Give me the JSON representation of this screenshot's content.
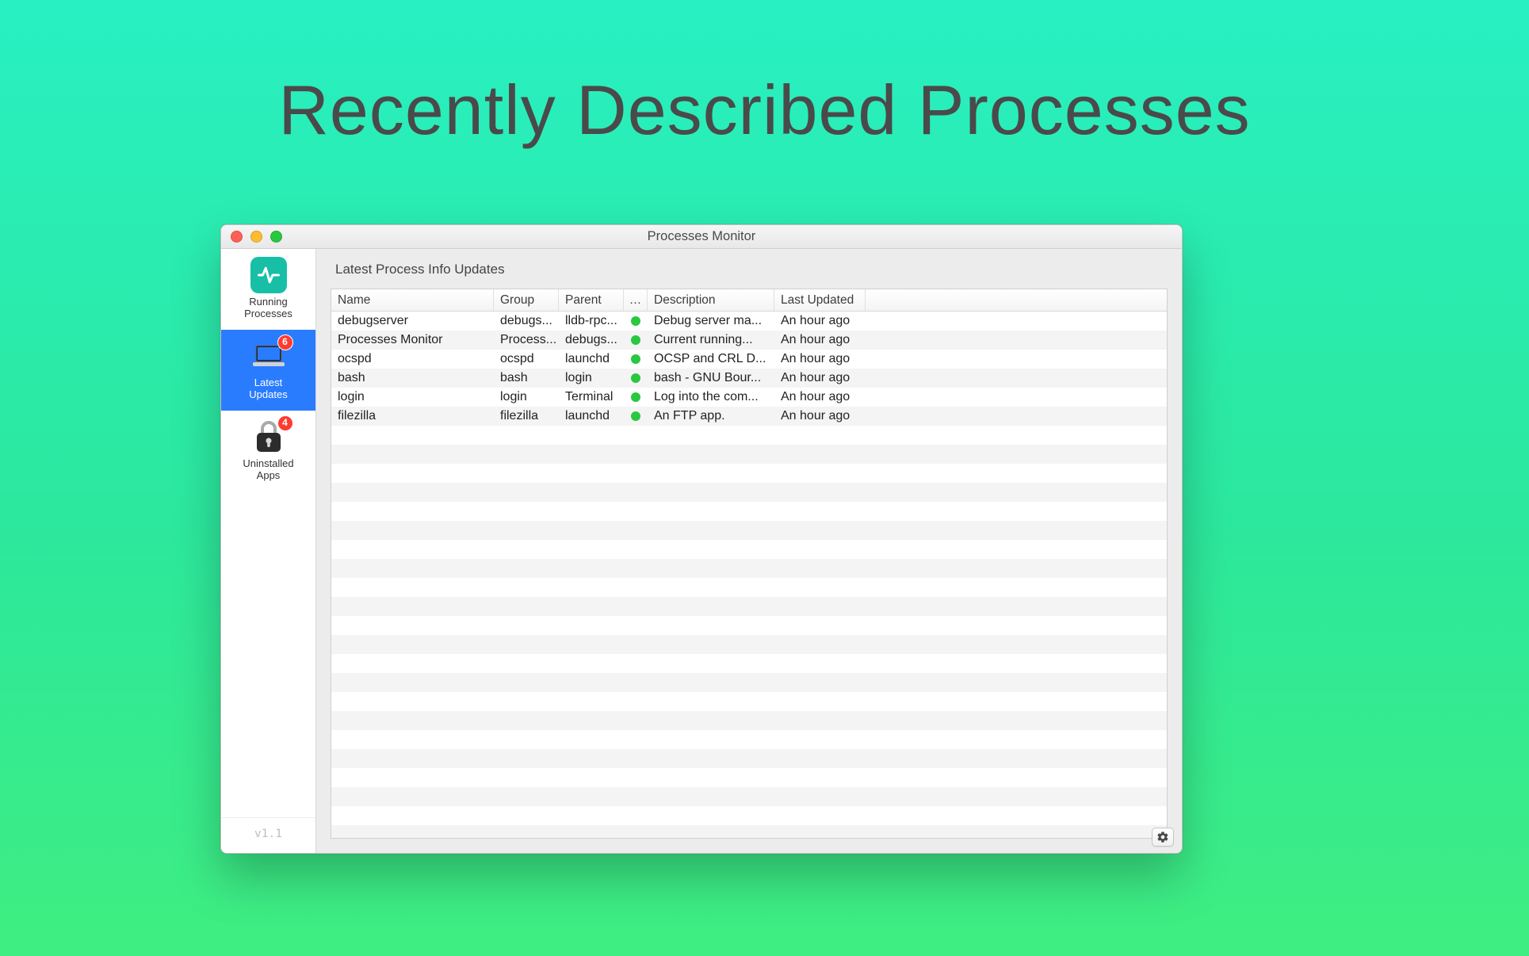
{
  "hero": {
    "title": "Recently Described Processes"
  },
  "window": {
    "title": "Processes Monitor"
  },
  "sidebar": {
    "items": [
      {
        "label": "Running\nProcesses",
        "badge": null,
        "selected": false,
        "icon": "running"
      },
      {
        "label": "Latest\nUpdates",
        "badge": "6",
        "selected": true,
        "icon": "laptop"
      },
      {
        "label": "Uninstalled\nApps",
        "badge": "4",
        "selected": false,
        "icon": "lock"
      }
    ],
    "footer": "v1.1"
  },
  "main": {
    "header": "Latest Process Info Updates",
    "columns": {
      "name": "Name",
      "group": "Group",
      "parent": "Parent",
      "status": "…",
      "description": "Description",
      "lastUpdated": "Last Updated"
    },
    "statusColor": "#28c840",
    "rows": [
      {
        "name": "debugserver",
        "group": "debugs...",
        "parent": "lldb-rpc...",
        "description": "Debug server ma...",
        "lastUpdated": "An hour ago"
      },
      {
        "name": "Processes Monitor",
        "group": "Process...",
        "parent": "debugs...",
        "description": "Current running...",
        "lastUpdated": "An hour ago"
      },
      {
        "name": "ocspd",
        "group": "ocspd",
        "parent": "launchd",
        "description": "OCSP and CRL D...",
        "lastUpdated": "An hour ago"
      },
      {
        "name": "bash",
        "group": "bash",
        "parent": "login",
        "description": "bash - GNU Bour...",
        "lastUpdated": "An hour ago"
      },
      {
        "name": "login",
        "group": "login",
        "parent": "Terminal",
        "description": "Log into the com...",
        "lastUpdated": "An hour ago"
      },
      {
        "name": "filezilla",
        "group": "filezilla",
        "parent": "launchd",
        "description": "An FTP app.",
        "lastUpdated": "An hour ago"
      }
    ],
    "emptyRowCount": 22
  }
}
